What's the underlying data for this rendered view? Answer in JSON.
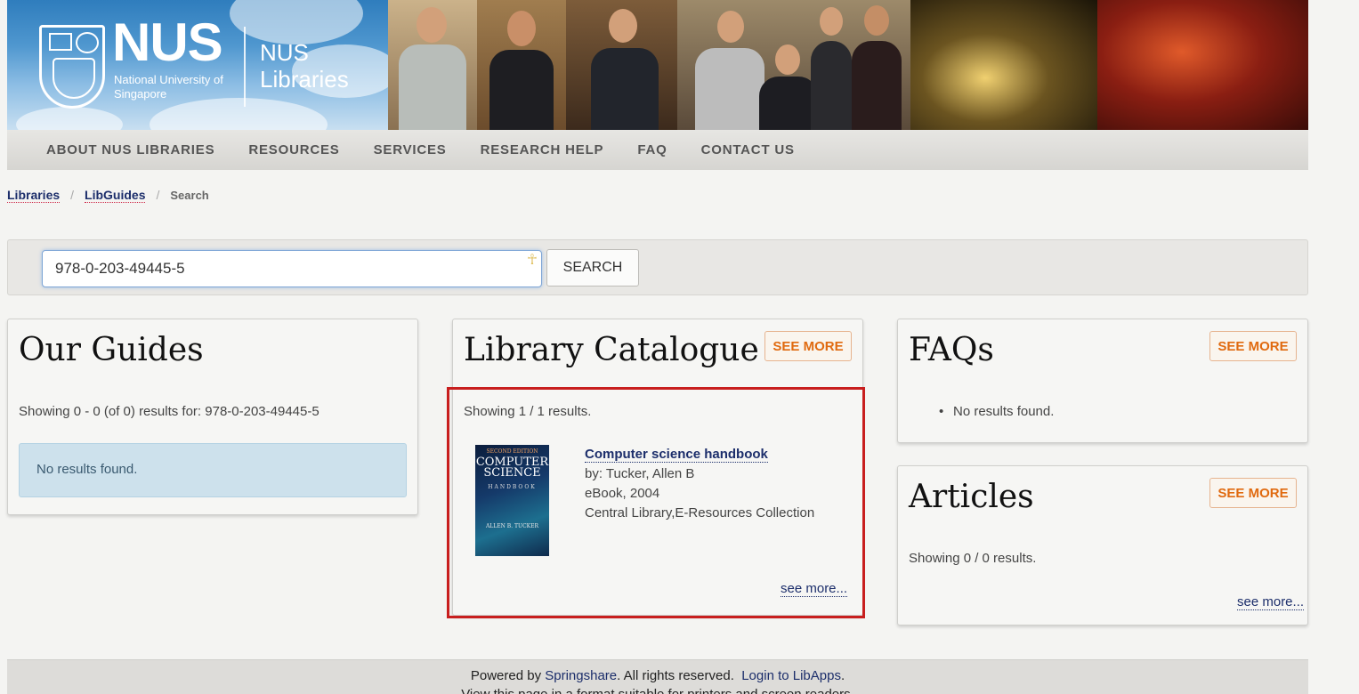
{
  "header": {
    "brand_name": "NUS",
    "brand_subtitle": "National University of Singapore",
    "brand_libraries": "NUS Libraries"
  },
  "nav": {
    "items": [
      "ABOUT NUS LIBRARIES",
      "RESOURCES",
      "SERVICES",
      "RESEARCH HELP",
      "FAQ",
      "CONTACT US"
    ]
  },
  "breadcrumb": {
    "items": [
      "Libraries",
      "LibGuides"
    ],
    "current": "Search",
    "separator": "/"
  },
  "search": {
    "value": "978-0-203-49445-5",
    "button_label": "SEARCH"
  },
  "guides": {
    "title": "Our Guides",
    "summary": "Showing 0 - 0 (of 0) results for: 978-0-203-49445-5",
    "alert": "No results found."
  },
  "catalogue": {
    "title": "Library Catalogue",
    "see_more_button": "SEE MORE",
    "summary": "Showing 1 / 1 results.",
    "result": {
      "title": "Computer science handbook",
      "author": "by: Tucker, Allen B",
      "format": "eBook, 2004",
      "location": "Central Library,E-Resources Collection",
      "cover_edition": "SECOND EDITION",
      "cover_title": "COMPUTER SCIENCE",
      "cover_subtitle": "HANDBOOK",
      "cover_author": "ALLEN B. TUCKER"
    },
    "see_more_link": "see more..."
  },
  "faqs": {
    "title": "FAQs",
    "see_more_button": "SEE MORE",
    "empty": "No results found."
  },
  "articles": {
    "title": "Articles",
    "see_more_button": "SEE MORE",
    "summary": "Showing 0 / 0 results.",
    "see_more_link": "see more..."
  },
  "footer": {
    "powered_by": "Powered by",
    "springshare": "Springshare",
    "rights": ". All rights reserved.",
    "login": "Login to LibApps",
    "login_suffix": ".",
    "line2": "View this page in a format suitable for printers and screen readers."
  },
  "colors": {
    "accent_orange": "#e06a10",
    "link_navy": "#1c2e6b",
    "highlight_red": "#c81e1e",
    "alert_blue": "#cde1ec"
  }
}
